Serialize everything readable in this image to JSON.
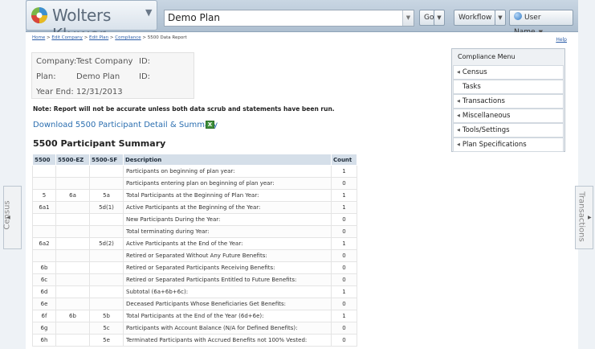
{
  "brand": {
    "name": "Wolters Kluwer"
  },
  "header": {
    "plan_select_value": "Demo Plan",
    "go_label": "Go",
    "workflow_label": "Workflow",
    "user_label": "User Name"
  },
  "breadcrumb": {
    "items": [
      "Home",
      "Edit Company",
      "Edit Plan",
      "Compliance"
    ],
    "current": "5500 Data Report",
    "separator": ">"
  },
  "help_label": "Help",
  "info": {
    "company_label": "Company:",
    "company_value": "Test Company",
    "company_id_label": "ID:",
    "plan_label": "Plan:",
    "plan_value": "Demo Plan",
    "plan_id_label": "ID:",
    "year_end_label": "Year End:",
    "year_end_value": "12/31/2013"
  },
  "note": "Note: Report will not be accurate unless both data scrub and statements have been run.",
  "download_link": "Download 5500 Participant Detail & Summary",
  "section_title": "5500 Participant Summary",
  "table": {
    "headers": [
      "5500",
      "5500-EZ",
      "5500-SF",
      "Description",
      "Count"
    ],
    "rows": [
      [
        "",
        "",
        "",
        "Participants on beginning of plan year:",
        "1"
      ],
      [
        "",
        "",
        "",
        "Participants entering plan on beginning of plan year:",
        "0"
      ],
      [
        "5",
        "6a",
        "5a",
        "Total Participants at the Beginning of Plan Year:",
        "1"
      ],
      [
        "6a1",
        "",
        "5d(1)",
        "Active Participants at the Beginning of the Year:",
        "1"
      ],
      [
        "",
        "",
        "",
        "New Participants During the Year:",
        "0"
      ],
      [
        "",
        "",
        "",
        "Total terminating during Year:",
        "0"
      ],
      [
        "6a2",
        "",
        "5d(2)",
        "Active Participants at the End of the Year:",
        "1"
      ],
      [
        "",
        "",
        "",
        "Retired or Separated Without Any Future Benefits:",
        "0"
      ],
      [
        "6b",
        "",
        "",
        "Retired or Separated Participants Receiving Benefits:",
        "0"
      ],
      [
        "6c",
        "",
        "",
        "Retired or Separated Participants Entitled to Future Benefits:",
        "0"
      ],
      [
        "6d",
        "",
        "",
        "Subtotal (6a+6b+6c):",
        "1"
      ],
      [
        "6e",
        "",
        "",
        "Deceased Participants Whose Beneficiaries Get Benefits:",
        "0"
      ],
      [
        "6f",
        "6b",
        "5b",
        "Total Participants at the End of the Year (6d+6e):",
        "1"
      ],
      [
        "6g",
        "",
        "5c",
        "Participants with Account Balance (N/A for Defined Benefits):",
        "0"
      ],
      [
        "6h",
        "",
        "5e",
        "Terminated Participants with Accrued Benefits not 100% Vested:",
        "0"
      ]
    ]
  },
  "compliance_menu": {
    "title": "Compliance Menu",
    "items": [
      {
        "label": "Census",
        "has_arrow": true
      },
      {
        "label": "Tasks",
        "has_arrow": false
      },
      {
        "label": "Transactions",
        "has_arrow": true
      },
      {
        "label": "Miscellaneous",
        "has_arrow": true
      },
      {
        "label": "Tools/Settings",
        "has_arrow": true
      },
      {
        "label": "Plan Specifications",
        "has_arrow": true
      }
    ]
  },
  "side_tabs": {
    "left": "Census",
    "right": "Transactions"
  },
  "colors": {
    "link": "#2c5ea8",
    "table_header_bg": "#d5dfe9",
    "excel_green": "#3f8f3a"
  },
  "icons": [
    "wolters-kluwer-logo-icon",
    "chevron-down-icon",
    "user-globe-icon",
    "excel-icon",
    "triangle-right-icon",
    "triangle-left-icon"
  ]
}
